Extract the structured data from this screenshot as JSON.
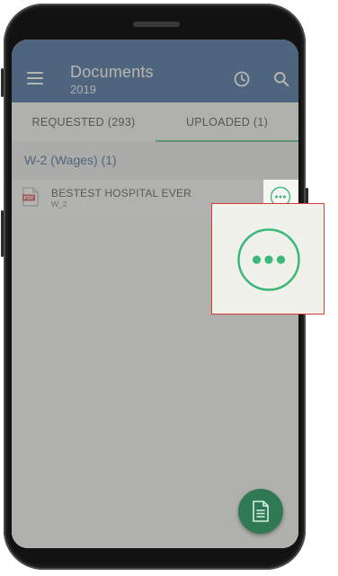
{
  "app_bar": {
    "title": "Documents",
    "subtitle": "2019",
    "menu_icon": "menu-icon",
    "history_icon": "clock-icon",
    "search_icon": "search-icon"
  },
  "tabs": [
    {
      "label": "REQUESTED (293)"
    },
    {
      "label": "UPLOADED (1)"
    }
  ],
  "group": {
    "title": "W-2 (Wages) (1)"
  },
  "items": [
    {
      "title": "BESTEST HOSPITAL EVER",
      "subtitle": "W_2",
      "icon": "pdf-file-icon",
      "icon_text": "PDF",
      "more_icon": "more-horizontal-icon"
    }
  ],
  "fab": {
    "icon": "document-icon"
  },
  "callout": {
    "icon": "more-horizontal-icon"
  },
  "colors": {
    "app_bar": "#1d4f86",
    "accent_green": "#3cb879",
    "fab": "#2f7a55",
    "pdf_red": "#c9302c",
    "highlight_border": "#d43a3a"
  }
}
